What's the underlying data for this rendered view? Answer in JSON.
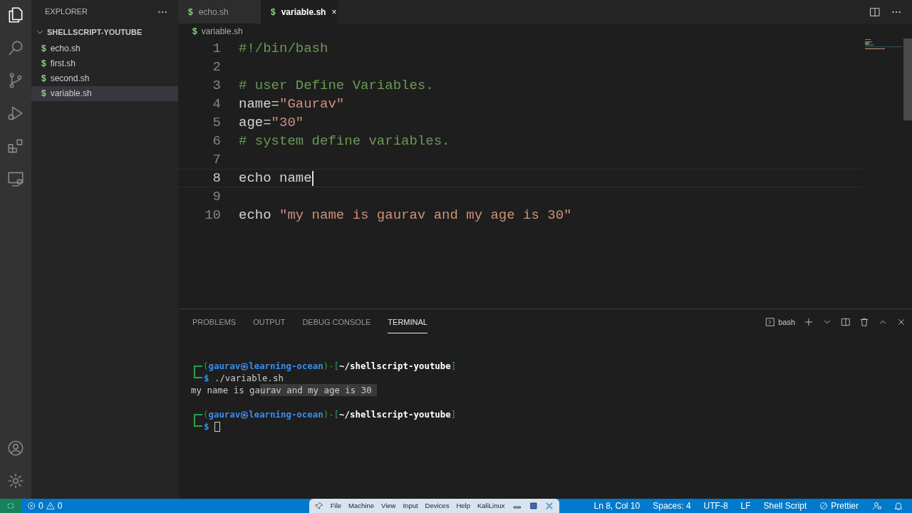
{
  "sidebar": {
    "title": "EXPLORER",
    "folder": {
      "name": "SHELLSCRIPT-YOUTUBE",
      "expanded": true,
      "files": [
        {
          "name": "echo.sh",
          "icon": "$",
          "selected": false
        },
        {
          "name": "first.sh",
          "icon": "$",
          "selected": false
        },
        {
          "name": "second.sh",
          "icon": "$",
          "selected": false
        },
        {
          "name": "variable.sh",
          "icon": "$",
          "selected": true
        }
      ]
    }
  },
  "tabs": [
    {
      "label": "echo.sh",
      "icon": "$",
      "selected": false
    },
    {
      "label": "variable.sh",
      "icon": "$",
      "selected": true,
      "close": "×"
    }
  ],
  "breadcrumb": {
    "icon": "$",
    "label": "variable.sh"
  },
  "code_lines": [
    {
      "number": "1",
      "tokens": [
        {
          "text": "#!/bin/bash",
          "kind": "comment"
        }
      ]
    },
    {
      "number": "2"
    },
    {
      "number": "3",
      "tokens": [
        {
          "text": "# user Define Variables.",
          "kind": "comment"
        }
      ]
    },
    {
      "number": "4",
      "tokens": [
        {
          "text": "name=",
          "kind": "plain"
        },
        {
          "text": "\"Gaurav\"",
          "kind": "string"
        }
      ]
    },
    {
      "number": "5",
      "tokens": [
        {
          "text": "age=",
          "kind": "plain"
        },
        {
          "text": "\"30\"",
          "kind": "string"
        }
      ]
    },
    {
      "number": "6",
      "tokens": [
        {
          "text": "# system define variables.",
          "kind": "comment"
        }
      ]
    },
    {
      "number": "7"
    },
    {
      "number": "8",
      "tokens": [
        {
          "text": "echo name",
          "kind": "plain"
        }
      ],
      "current": true
    },
    {
      "number": "9"
    },
    {
      "number": "10",
      "tokens": [
        {
          "text": "echo ",
          "kind": "plain"
        },
        {
          "text": "\"my name is gaurav and my age is 30\"",
          "kind": "string"
        }
      ]
    }
  ],
  "panel": {
    "tabs": [
      {
        "label": "PROBLEMS",
        "selected": false
      },
      {
        "label": "OUTPUT",
        "selected": false
      },
      {
        "label": "DEBUG CONSOLE",
        "selected": false
      },
      {
        "label": "TERMINAL",
        "selected": true
      }
    ],
    "shell": "bash",
    "terminal_lines": [
      {
        "kind": "blank"
      },
      {
        "kind": "prompt",
        "segments": [
          {
            "text": "(",
            "kind": "frame"
          },
          {
            "text": "gaurav㉿learning-ocean",
            "kind": "user"
          },
          {
            "text": ")-[",
            "kind": "frame"
          },
          {
            "text": "~/shellscript-youtube",
            "kind": "path"
          },
          {
            "text": "]",
            "kind": "frame"
          }
        ]
      },
      {
        "kind": "command",
        "sign": "$",
        "text": "./variable.sh"
      },
      {
        "kind": "output",
        "segments": [
          {
            "text": "my name is ga",
            "selected": false
          },
          {
            "text": "urav and my age is 30 ",
            "selected": true
          }
        ]
      },
      {
        "kind": "blank"
      },
      {
        "kind": "prompt",
        "segments": [
          {
            "text": "(",
            "kind": "frame"
          },
          {
            "text": "gaurav㉿learning-ocean",
            "kind": "user"
          },
          {
            "text": ")-[",
            "kind": "frame"
          },
          {
            "text": "~/shellscript-youtube",
            "kind": "path"
          },
          {
            "text": "]",
            "kind": "frame"
          }
        ]
      },
      {
        "kind": "command",
        "sign": "$",
        "cursor": true
      }
    ]
  },
  "status_bar": {
    "errors": "0",
    "warnings": "0",
    "vm_menu": [
      "File",
      "Machine",
      "View",
      "Input",
      "Devices",
      "Help"
    ],
    "vm_name": "KaliLinux",
    "items": [
      "Ln 8, Col 10",
      "Spaces: 4",
      "UTF-8",
      "LF",
      "Shell Script"
    ],
    "prettier": "Prettier"
  }
}
